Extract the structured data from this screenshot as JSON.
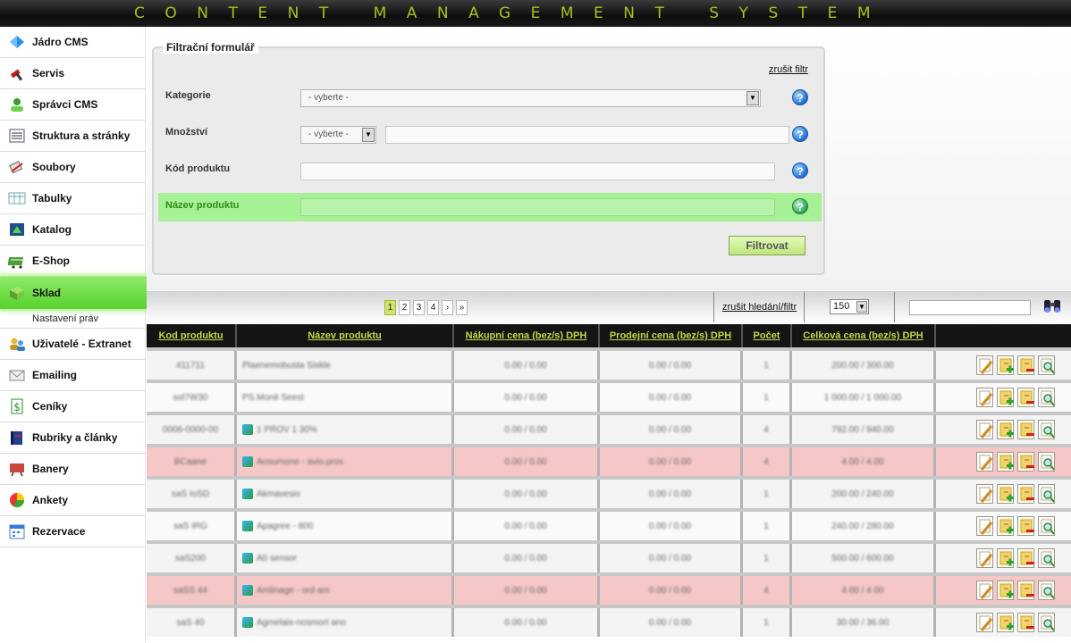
{
  "app": {
    "title": "CONTENT MANAGEMENT SYSTEM"
  },
  "sidebar": {
    "items": [
      {
        "label": "Jádro CMS",
        "icon": "diamond-icon"
      },
      {
        "label": "Servis",
        "icon": "hammer-icon"
      },
      {
        "label": "Správci CMS",
        "icon": "users-icon"
      },
      {
        "label": "Struktura a stránky",
        "icon": "list-icon"
      },
      {
        "label": "Soubory",
        "icon": "files-icon"
      },
      {
        "label": "Tabulky",
        "icon": "table-icon"
      },
      {
        "label": "Katalog",
        "icon": "catalog-icon"
      },
      {
        "label": "E-Shop",
        "icon": "cart-icon"
      },
      {
        "label": "Sklad",
        "icon": "box-icon",
        "active": true
      },
      {
        "label": "Uživatelé - Extranet",
        "icon": "user-group-icon"
      },
      {
        "label": "Emailing",
        "icon": "envelope-icon"
      },
      {
        "label": "Ceníky",
        "icon": "price-icon"
      },
      {
        "label": "Rubriky a články",
        "icon": "book-icon"
      },
      {
        "label": "Banery",
        "icon": "banner-icon"
      },
      {
        "label": "Ankety",
        "icon": "pie-icon"
      },
      {
        "label": "Rezervace",
        "icon": "calendar-icon"
      }
    ],
    "subitem": "Nastavení práv"
  },
  "filter": {
    "legend": "Filtrační formulář",
    "clear": "zrušit filtr",
    "category": {
      "label": "Kategorie",
      "value": "- vyberte -"
    },
    "quantity": {
      "label": "Množství",
      "value": "- vyberte -"
    },
    "code": {
      "label": "Kód produktu"
    },
    "name": {
      "label": "Název produktu"
    },
    "help": "?",
    "submit": "Filtrovat"
  },
  "toolbar": {
    "pages": [
      "1",
      "2",
      "3",
      "4",
      "›",
      "»"
    ],
    "current_page": "1",
    "clear_search": "zrušit hledání/filtr",
    "per_page": "150"
  },
  "table": {
    "columns": [
      "Kod produktu",
      "Název produktu",
      "Nákupní cena (bez/s) DPH",
      "Prodejní cena (bez/s) DPH",
      "Počet",
      "Celková cena (bez/s) DPH"
    ],
    "rows": [
      {
        "code": "411711",
        "name": "Plaenemobusta Siskle",
        "buy": "0.00 / 0.00",
        "sell": "0.00 / 0.00",
        "qty": "1",
        "total": "200.00 / 300.00",
        "status": "normal",
        "icon": false
      },
      {
        "code": "sol7W30",
        "name": "PS.Monit Seest",
        "buy": "0.00 / 0.00",
        "sell": "0.00 / 0.00",
        "qty": "1",
        "total": "1 000.00 / 1 000.00",
        "status": "normal",
        "icon": false
      },
      {
        "code": "0006-0000-00",
        "name": "1 PROV 1 30%",
        "buy": "0.00 / 0.00",
        "sell": "0.00 / 0.00",
        "qty": "4",
        "total": "792.00 / 940.00",
        "status": "normal",
        "icon": true
      },
      {
        "code": "BCaane",
        "name": "Aosumone - avio.pros",
        "buy": "0.00 / 0.00",
        "sell": "0.00 / 0.00",
        "qty": "4",
        "total": "4.00 / 4.00",
        "status": "warning",
        "icon": true
      },
      {
        "code": "saS IoSD",
        "name": "Akmavesio",
        "buy": "0.00 / 0.00",
        "sell": "0.00 / 0.00",
        "qty": "1",
        "total": "200.00 / 240.00",
        "status": "normal",
        "icon": true
      },
      {
        "code": "saS IRG",
        "name": "Apagree - 800",
        "buy": "0.00 / 0.00",
        "sell": "0.00 / 0.00",
        "qty": "1",
        "total": "240.00 / 280.00",
        "status": "normal",
        "icon": true
      },
      {
        "code": "saS200",
        "name": "A0 sensor",
        "buy": "0.00 / 0.00",
        "sell": "0.00 / 0.00",
        "qty": "1",
        "total": "500.00 / 600.00",
        "status": "normal",
        "icon": true
      },
      {
        "code": "saSS 44",
        "name": "Amlinage - ord am",
        "buy": "0.00 / 0.00",
        "sell": "0.00 / 0.00",
        "qty": "4",
        "total": "4.00 / 4.00",
        "status": "warning",
        "icon": true
      },
      {
        "code": "saS 40",
        "name": "Agmelais-nosmort ano",
        "buy": "0.00 / 0.00",
        "sell": "0.00 / 0.00",
        "qty": "1",
        "total": "30.00 / 36.00",
        "status": "normal",
        "icon": true
      }
    ],
    "actions": [
      "edit-icon",
      "add-icon",
      "remove-icon",
      "detail-icon"
    ]
  },
  "colors": {
    "accent": "#a8c21b",
    "active": "#58d12d",
    "warning_row": "#f6c7c7"
  }
}
